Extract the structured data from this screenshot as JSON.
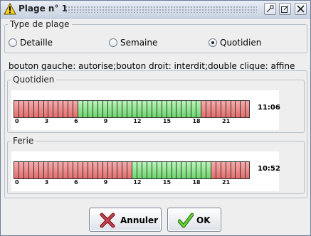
{
  "window": {
    "title": "Plage n° 1"
  },
  "type_group": {
    "legend": "Type de plage",
    "options": [
      {
        "label": "Detaille",
        "selected": false
      },
      {
        "label": "Semaine",
        "selected": false
      },
      {
        "label": "Quotidien",
        "selected": true
      }
    ]
  },
  "instructions": "bouton gauche: autorise;bouton droit: interdit;double clique: affine",
  "schedules": [
    {
      "legend": "Quotidien",
      "time": "11:06",
      "cells": [
        0,
        0,
        0,
        0,
        0,
        0,
        0,
        0,
        0,
        0,
        0,
        0,
        0,
        1,
        1,
        1,
        1,
        1,
        1,
        1,
        1,
        1,
        1,
        1,
        1,
        1,
        1,
        1,
        1,
        1,
        1,
        1,
        1,
        1,
        1,
        1,
        1,
        1,
        0,
        0,
        0,
        0,
        0,
        0,
        0,
        0,
        0,
        0
      ],
      "ticks": [
        "0",
        "3",
        "6",
        "9",
        "12",
        "15",
        "18",
        "21"
      ]
    },
    {
      "legend": "Ferie",
      "time": "10:52",
      "cells": [
        0,
        0,
        0,
        0,
        0,
        0,
        0,
        0,
        0,
        0,
        0,
        0,
        0,
        0,
        0,
        0,
        0,
        0,
        0,
        0,
        0,
        0,
        0,
        0,
        1,
        1,
        1,
        1,
        1,
        1,
        1,
        1,
        1,
        1,
        1,
        1,
        1,
        1,
        1,
        1,
        0,
        0,
        0,
        0,
        0,
        0,
        0,
        0
      ],
      "ticks": [
        "0",
        "3",
        "6",
        "9",
        "12",
        "15",
        "18",
        "21"
      ]
    }
  ],
  "buttons": {
    "cancel": "Annuler",
    "ok": "OK"
  },
  "colors": {
    "allowed": "#7ddc7d",
    "forbidden": "#ec8585"
  }
}
